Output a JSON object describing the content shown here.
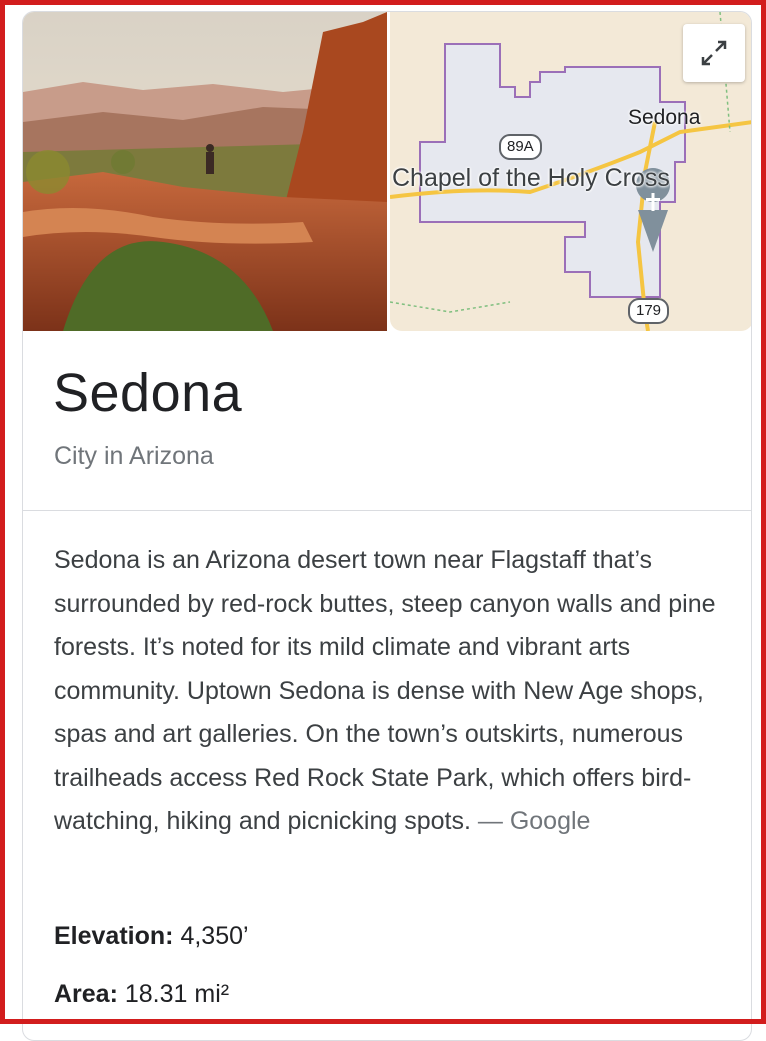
{
  "title": "Sedona",
  "subtitle": "City in Arizona",
  "map": {
    "city_label": "Sedona",
    "landmark_label": "Chapel of the Holy Cross",
    "route_89a": "89A",
    "route_179": "179"
  },
  "description": {
    "text": "Sedona is an Arizona desert town near Flagstaff that’s surrounded by red-rock buttes, steep canyon walls and pine forests. It’s noted for its mild climate and vibrant arts community. Uptown Sedona is dense with New Age shops, spas and art galleries. On the town’s outskirts, numerous trailheads access Red Rock State Park, which offers bird-watching, hiking and picnicking spots.",
    "source": "— Google"
  },
  "facts": [
    {
      "label": "Elevation:",
      "value": "4,350’"
    },
    {
      "label": "Area:",
      "value": "18.31 mi²"
    }
  ],
  "colors": {
    "frame": "#d21d1d",
    "map_land": "#f3e9d7",
    "boundary": "#9b6fb8",
    "road": "#f5c542"
  }
}
